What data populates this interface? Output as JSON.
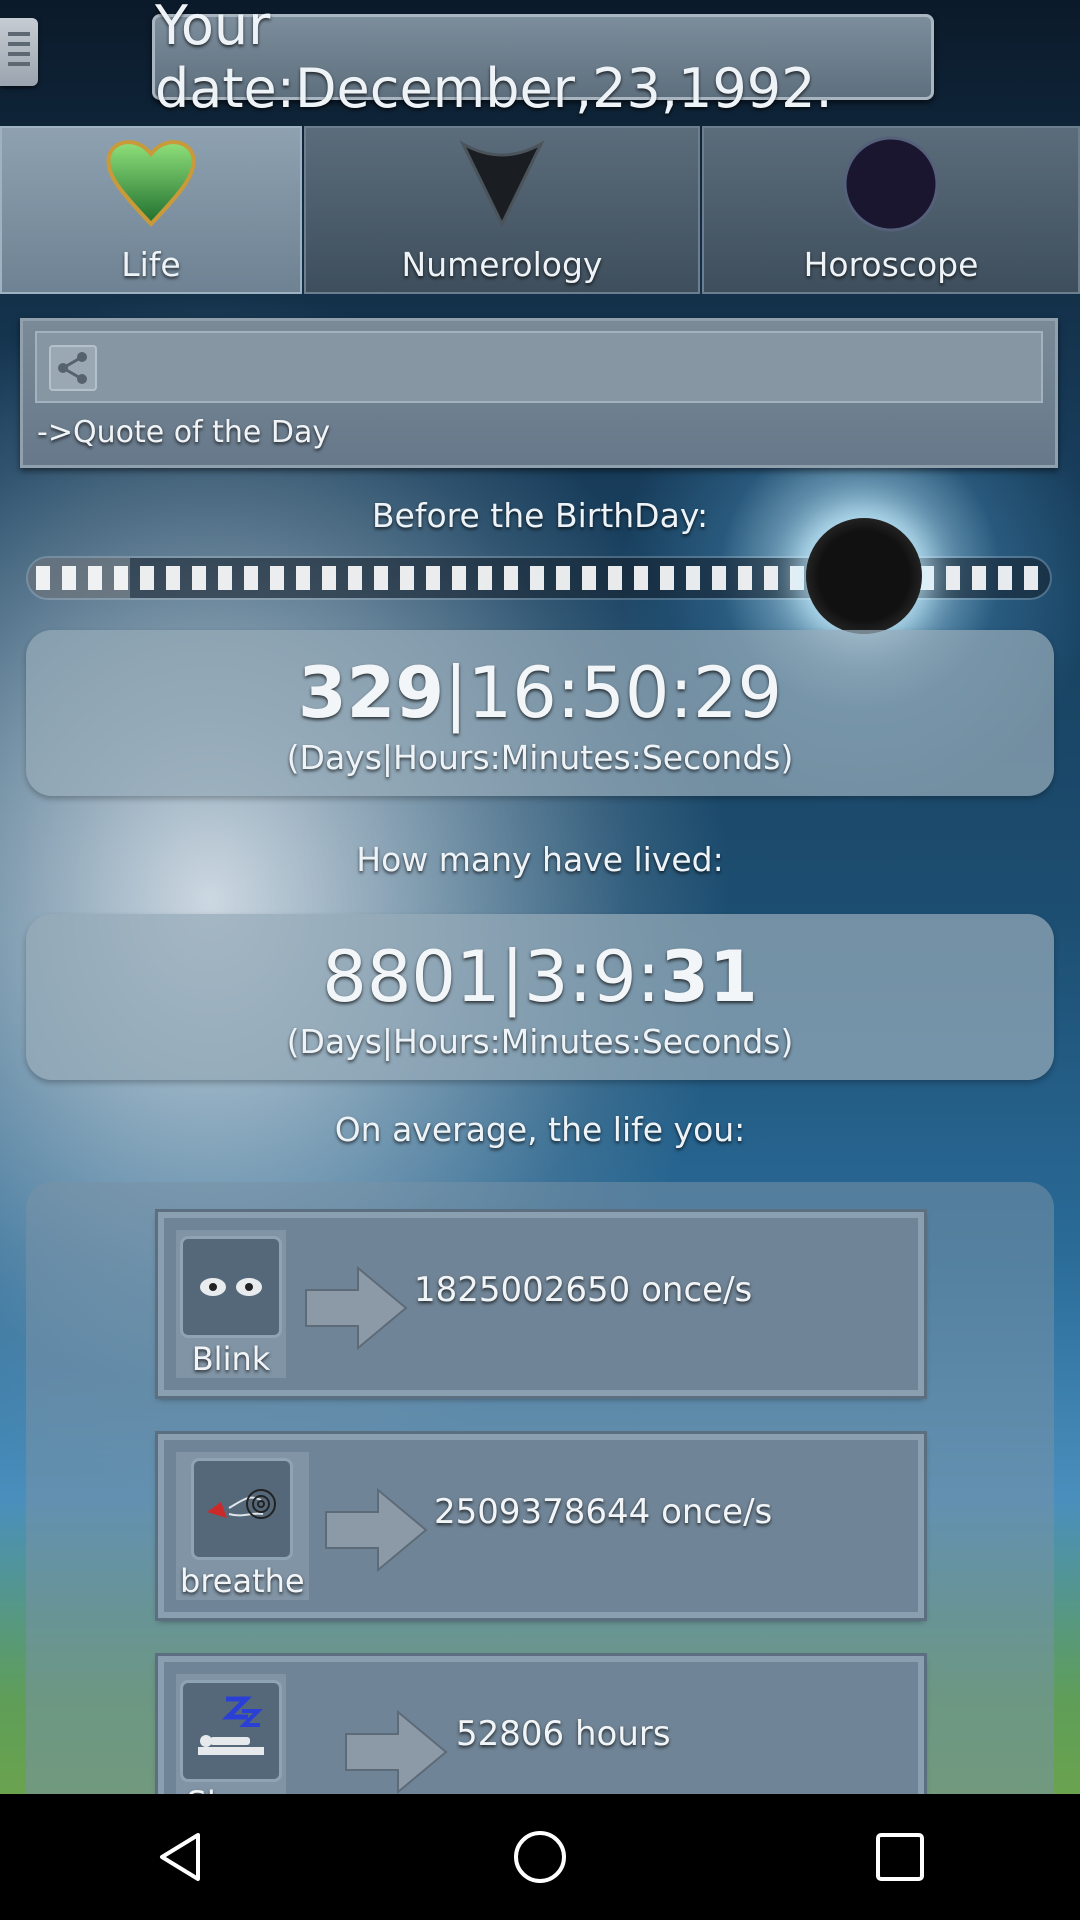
{
  "header": {
    "menu_icon": "hamburger-menu-icon",
    "date_label": "Your date:December,23,1992."
  },
  "tabs": [
    {
      "label": "Life",
      "icon": "heart-icon",
      "active": true
    },
    {
      "label": "Numerology",
      "icon": "triangle-down-icon",
      "active": false
    },
    {
      "label": "Horoscope",
      "icon": "dark-circle-icon",
      "active": false
    }
  ],
  "quote": {
    "share_icon": "share-icon",
    "label": "->Quote of the Day"
  },
  "birthday": {
    "title": "Before the BirthDay:",
    "progress_fraction": 0.1,
    "days": "329",
    "time": "|16:50:29",
    "units": "(Days|Hours:Minutes:Seconds)"
  },
  "lived": {
    "title": "How many have lived:",
    "prefix": "8801|3:9:",
    "seconds": "31",
    "units": "(Days|Hours:Minutes:Seconds)"
  },
  "average": {
    "title": "On average, the life you:",
    "stats": [
      {
        "label": "Blink",
        "icon": "eyes-icon",
        "value": "1825002650 once/s"
      },
      {
        "label": "breathe",
        "icon": "breath-icon",
        "value": "2509378644 once/s"
      },
      {
        "label": "Sleep",
        "icon": "sleep-icon",
        "value": "52806 hours"
      }
    ]
  },
  "navbar": {
    "back_icon": "back-triangle-icon",
    "home_icon": "home-circle-icon",
    "recents_icon": "recents-square-icon"
  },
  "colors": {
    "accent": "#8ea1b1",
    "heart": "#3da34a",
    "panel": "#6f8496"
  }
}
